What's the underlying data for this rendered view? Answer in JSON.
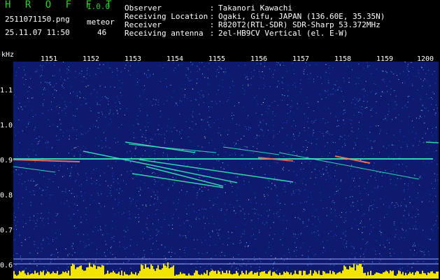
{
  "header": {
    "app_title": "H R O F F T",
    "version": "1.0.0",
    "filename": "2511071150.png",
    "mode": "meteor",
    "datetime": "25.11.07 11:50",
    "count": "46"
  },
  "info": [
    {
      "key": "Observer",
      "value": "Takanori Kawachi"
    },
    {
      "key": "Receiving Location",
      "value": "Ogaki, Gifu, JAPAN (136.60E, 35.35N)"
    },
    {
      "key": "Receiver",
      "value": "R820T2(RTL-SDR) SDR-Sharp 53.372MHz"
    },
    {
      "key": "Receiving antenna",
      "value": "2el-HB9CV Vertical (el. E-W)"
    }
  ],
  "plot": {
    "freq_unit": "kHz",
    "y_ticks": [
      "1.1",
      "1.0",
      "0.9",
      "0.8",
      "0.7",
      "0.6"
    ],
    "time_ticks": [
      "1151",
      "1152",
      "1153",
      "1154",
      "1155",
      "1156",
      "1157",
      "1158",
      "1159",
      "1200"
    ],
    "colors": {
      "background": "#0d1a6e",
      "trace": "#40f0c0",
      "bars": "#f0e400",
      "axis": "#ffffff"
    }
  }
}
